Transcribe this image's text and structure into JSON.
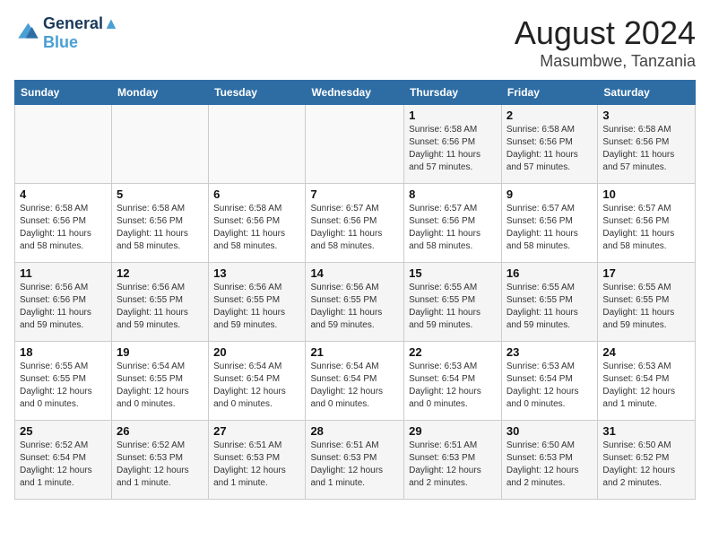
{
  "header": {
    "logo_line1": "General",
    "logo_line2": "Blue",
    "month": "August 2024",
    "location": "Masumbwe, Tanzania"
  },
  "weekdays": [
    "Sunday",
    "Monday",
    "Tuesday",
    "Wednesday",
    "Thursday",
    "Friday",
    "Saturday"
  ],
  "weeks": [
    [
      {
        "day": "",
        "detail": ""
      },
      {
        "day": "",
        "detail": ""
      },
      {
        "day": "",
        "detail": ""
      },
      {
        "day": "",
        "detail": ""
      },
      {
        "day": "1",
        "detail": "Sunrise: 6:58 AM\nSunset: 6:56 PM\nDaylight: 11 hours\nand 57 minutes."
      },
      {
        "day": "2",
        "detail": "Sunrise: 6:58 AM\nSunset: 6:56 PM\nDaylight: 11 hours\nand 57 minutes."
      },
      {
        "day": "3",
        "detail": "Sunrise: 6:58 AM\nSunset: 6:56 PM\nDaylight: 11 hours\nand 57 minutes."
      }
    ],
    [
      {
        "day": "4",
        "detail": "Sunrise: 6:58 AM\nSunset: 6:56 PM\nDaylight: 11 hours\nand 58 minutes."
      },
      {
        "day": "5",
        "detail": "Sunrise: 6:58 AM\nSunset: 6:56 PM\nDaylight: 11 hours\nand 58 minutes."
      },
      {
        "day": "6",
        "detail": "Sunrise: 6:58 AM\nSunset: 6:56 PM\nDaylight: 11 hours\nand 58 minutes."
      },
      {
        "day": "7",
        "detail": "Sunrise: 6:57 AM\nSunset: 6:56 PM\nDaylight: 11 hours\nand 58 minutes."
      },
      {
        "day": "8",
        "detail": "Sunrise: 6:57 AM\nSunset: 6:56 PM\nDaylight: 11 hours\nand 58 minutes."
      },
      {
        "day": "9",
        "detail": "Sunrise: 6:57 AM\nSunset: 6:56 PM\nDaylight: 11 hours\nand 58 minutes."
      },
      {
        "day": "10",
        "detail": "Sunrise: 6:57 AM\nSunset: 6:56 PM\nDaylight: 11 hours\nand 58 minutes."
      }
    ],
    [
      {
        "day": "11",
        "detail": "Sunrise: 6:56 AM\nSunset: 6:56 PM\nDaylight: 11 hours\nand 59 minutes."
      },
      {
        "day": "12",
        "detail": "Sunrise: 6:56 AM\nSunset: 6:55 PM\nDaylight: 11 hours\nand 59 minutes."
      },
      {
        "day": "13",
        "detail": "Sunrise: 6:56 AM\nSunset: 6:55 PM\nDaylight: 11 hours\nand 59 minutes."
      },
      {
        "day": "14",
        "detail": "Sunrise: 6:56 AM\nSunset: 6:55 PM\nDaylight: 11 hours\nand 59 minutes."
      },
      {
        "day": "15",
        "detail": "Sunrise: 6:55 AM\nSunset: 6:55 PM\nDaylight: 11 hours\nand 59 minutes."
      },
      {
        "day": "16",
        "detail": "Sunrise: 6:55 AM\nSunset: 6:55 PM\nDaylight: 11 hours\nand 59 minutes."
      },
      {
        "day": "17",
        "detail": "Sunrise: 6:55 AM\nSunset: 6:55 PM\nDaylight: 11 hours\nand 59 minutes."
      }
    ],
    [
      {
        "day": "18",
        "detail": "Sunrise: 6:55 AM\nSunset: 6:55 PM\nDaylight: 12 hours\nand 0 minutes."
      },
      {
        "day": "19",
        "detail": "Sunrise: 6:54 AM\nSunset: 6:55 PM\nDaylight: 12 hours\nand 0 minutes."
      },
      {
        "day": "20",
        "detail": "Sunrise: 6:54 AM\nSunset: 6:54 PM\nDaylight: 12 hours\nand 0 minutes."
      },
      {
        "day": "21",
        "detail": "Sunrise: 6:54 AM\nSunset: 6:54 PM\nDaylight: 12 hours\nand 0 minutes."
      },
      {
        "day": "22",
        "detail": "Sunrise: 6:53 AM\nSunset: 6:54 PM\nDaylight: 12 hours\nand 0 minutes."
      },
      {
        "day": "23",
        "detail": "Sunrise: 6:53 AM\nSunset: 6:54 PM\nDaylight: 12 hours\nand 0 minutes."
      },
      {
        "day": "24",
        "detail": "Sunrise: 6:53 AM\nSunset: 6:54 PM\nDaylight: 12 hours\nand 1 minute."
      }
    ],
    [
      {
        "day": "25",
        "detail": "Sunrise: 6:52 AM\nSunset: 6:54 PM\nDaylight: 12 hours\nand 1 minute."
      },
      {
        "day": "26",
        "detail": "Sunrise: 6:52 AM\nSunset: 6:53 PM\nDaylight: 12 hours\nand 1 minute."
      },
      {
        "day": "27",
        "detail": "Sunrise: 6:51 AM\nSunset: 6:53 PM\nDaylight: 12 hours\nand 1 minute."
      },
      {
        "day": "28",
        "detail": "Sunrise: 6:51 AM\nSunset: 6:53 PM\nDaylight: 12 hours\nand 1 minute."
      },
      {
        "day": "29",
        "detail": "Sunrise: 6:51 AM\nSunset: 6:53 PM\nDaylight: 12 hours\nand 2 minutes."
      },
      {
        "day": "30",
        "detail": "Sunrise: 6:50 AM\nSunset: 6:53 PM\nDaylight: 12 hours\nand 2 minutes."
      },
      {
        "day": "31",
        "detail": "Sunrise: 6:50 AM\nSunset: 6:52 PM\nDaylight: 12 hours\nand 2 minutes."
      }
    ]
  ]
}
